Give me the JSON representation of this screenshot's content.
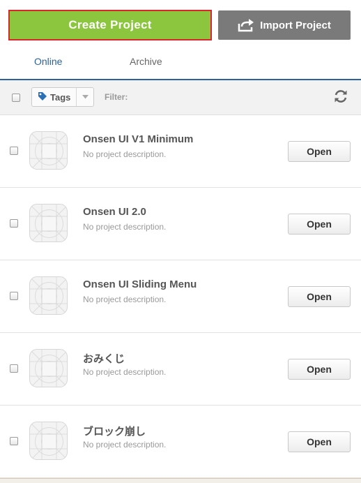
{
  "top_buttons": {
    "create_label": "Create Project",
    "import_label": "Import Project"
  },
  "tabs": [
    {
      "label": "Online",
      "active": true
    },
    {
      "label": "Archive",
      "active": false
    }
  ],
  "toolbar": {
    "tags_label": "Tags",
    "filter_label": "Filter:",
    "icons": {
      "tag": "tag-icon",
      "caret": "chevron-down-icon",
      "refresh": "refresh-icon"
    }
  },
  "projects": [
    {
      "title": "Onsen UI V1 Minimum",
      "description": "No project description.",
      "open_label": "Open"
    },
    {
      "title": "Onsen UI 2.0",
      "description": "No project description.",
      "open_label": "Open"
    },
    {
      "title": "Onsen UI Sliding Menu",
      "description": "No project description.",
      "open_label": "Open"
    },
    {
      "title": "おみくじ",
      "description": "No project description.",
      "open_label": "Open"
    },
    {
      "title": "ブロック崩し",
      "description": "No project description.",
      "open_label": "Open"
    }
  ],
  "colors": {
    "create_bg": "#8cc63f",
    "create_border": "#d9262c",
    "import_bg": "#7a7a7a",
    "tab_active": "#2d6198",
    "tag_icon": "#2b6fb4"
  }
}
